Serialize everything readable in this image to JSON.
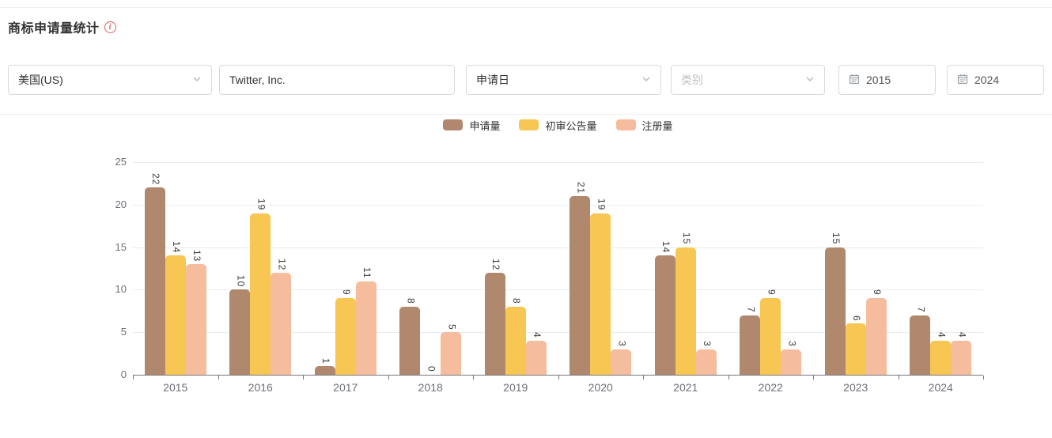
{
  "header": {
    "title": "商标申请量统计"
  },
  "filters": {
    "region": {
      "value": "美国(US)"
    },
    "applicant": {
      "value": "Twitter, Inc."
    },
    "date_type": {
      "value": "申请日"
    },
    "category": {
      "placeholder": "类别"
    },
    "year_from": {
      "value": "2015"
    },
    "year_to": {
      "value": "2024"
    }
  },
  "chart_data": {
    "type": "bar",
    "title": "商标申请量统计",
    "categories": [
      "2015",
      "2016",
      "2017",
      "2018",
      "2019",
      "2020",
      "2021",
      "2022",
      "2023",
      "2024"
    ],
    "series": [
      {
        "name": "申请量",
        "color": "#b0886d",
        "values": [
          22,
          10,
          1,
          8,
          12,
          21,
          14,
          7,
          15,
          7
        ]
      },
      {
        "name": "初审公告量",
        "color": "#f8c653",
        "values": [
          14,
          19,
          9,
          0,
          8,
          19,
          15,
          9,
          6,
          4
        ]
      },
      {
        "name": "注册量",
        "color": "#f5bd9d",
        "values": [
          13,
          12,
          11,
          5,
          4,
          3,
          3,
          3,
          9,
          4
        ]
      }
    ],
    "xlabel": "",
    "ylabel": "",
    "ylim": [
      0,
      25
    ],
    "yticks": [
      0,
      5,
      10,
      15,
      20,
      25
    ],
    "grid": true,
    "legend_position": "top-center",
    "value_labels": "rotated-vertical"
  }
}
